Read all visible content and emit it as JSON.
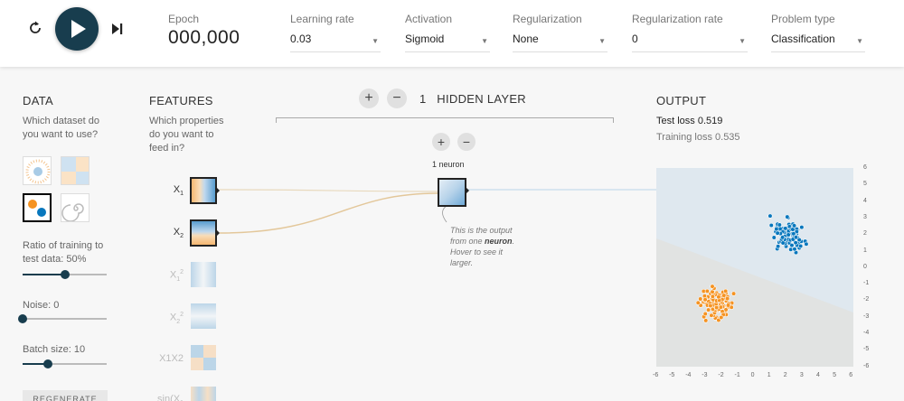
{
  "toolbar": {
    "reset_icon": "reset-icon",
    "play_icon": "play-icon",
    "step_icon": "step-forward-icon",
    "epoch_label": "Epoch",
    "epoch_value": "000,000",
    "learning_rate_label": "Learning rate",
    "learning_rate_value": "0.03",
    "activation_label": "Activation",
    "activation_value": "Sigmoid",
    "regularization_label": "Regularization",
    "regularization_value": "None",
    "reg_rate_label": "Regularization rate",
    "reg_rate_value": "0",
    "problem_type_label": "Problem type",
    "problem_type_value": "Classification"
  },
  "data_panel": {
    "title": "DATA",
    "question": "Which dataset do you want to use?",
    "ratio_label": "Ratio of training to test data:",
    "ratio_value": "50%",
    "ratio_fraction": 0.5,
    "noise_label": "Noise:",
    "noise_value": "0",
    "noise_fraction": 0.0,
    "batch_label": "Batch size:",
    "batch_value": "10",
    "batch_fraction": 0.3,
    "regenerate_label": "REGENERATE"
  },
  "features_panel": {
    "title": "FEATURES",
    "question": "Which properties do you want to feed in?",
    "features": [
      {
        "label": "X",
        "sub": "1",
        "sup": "",
        "active": true
      },
      {
        "label": "X",
        "sub": "2",
        "sup": "",
        "active": true
      },
      {
        "label": "X",
        "sub": "1",
        "sup": "2",
        "active": false
      },
      {
        "label": "X",
        "sub": "2",
        "sup": "2",
        "active": false
      },
      {
        "label": "X1X2",
        "sub": "",
        "sup": "",
        "active": false
      },
      {
        "label": "sin(X",
        "sub": "1",
        "sup": "",
        "active": false
      }
    ]
  },
  "hidden_layers": {
    "count": "1",
    "title": "HIDDEN LAYER",
    "neuron_count_label": "1 neuron",
    "add_layer": "+",
    "remove_layer": "−",
    "add_neuron": "+",
    "remove_neuron": "−",
    "callout_text_1": "This is the output from one",
    "callout_bold": "neuron",
    "callout_text_2": ". Hover to see it larger."
  },
  "output_panel": {
    "title": "OUTPUT",
    "test_loss_label": "Test loss",
    "test_loss_value": "0.519",
    "training_loss_label": "Training loss",
    "training_loss_value": "0.535",
    "x_ticks": [
      "-6",
      "-5",
      "-4",
      "-3",
      "-2",
      "-1",
      "0",
      "1",
      "2",
      "3",
      "4",
      "5",
      "6"
    ],
    "y_ticks": [
      "6",
      "5",
      "4",
      "3",
      "2",
      "1",
      "0",
      "-1",
      "-2",
      "-3",
      "-4",
      "-5",
      "-6"
    ]
  },
  "colors": {
    "accent": "#183d4e",
    "positive": "#0877bd",
    "negative": "#f59322",
    "plot_bg": "#dfe8ef"
  }
}
